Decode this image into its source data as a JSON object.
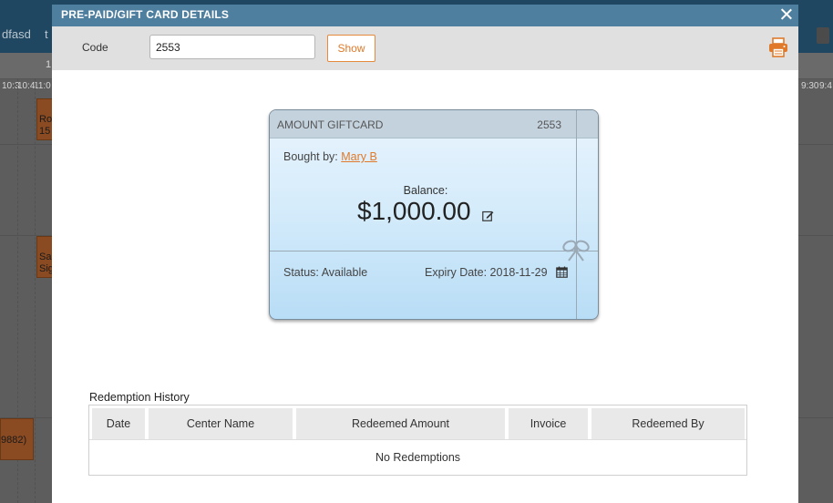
{
  "background": {
    "tabs": [
      "dfasd",
      "t"
    ],
    "hours": [
      "1",
      "10:3",
      "10:4",
      "11:0",
      "9:30",
      "9:4"
    ],
    "appointments": [
      {
        "text": "Ro 15"
      },
      {
        "text": "Sa Sig"
      },
      {
        "text": "9882)"
      }
    ]
  },
  "modal": {
    "title": "PRE-PAID/GIFT CARD DETAILS",
    "close_icon": "close-icon",
    "toolbar": {
      "code_label": "Code",
      "code_value": "2553",
      "show_label": "Show",
      "print_icon": "printer-icon"
    },
    "card": {
      "type": "AMOUNT GIFTCARD",
      "code": "2553",
      "bought_by_label": "Bought by:",
      "bought_by_name": "Mary B",
      "balance_label": "Balance:",
      "balance": "$1,000.00",
      "status": "Status: Available",
      "expiry": "Expiry Date: 2018-11-29"
    },
    "history": {
      "title": "Redemption History",
      "columns": [
        "Date",
        "Center Name",
        "Redeemed Amount",
        "Invoice",
        "Redeemed By"
      ],
      "empty_text": "No Redemptions"
    },
    "colors": {
      "header": "#4f7f9f",
      "accent": "#e07a2a",
      "toolbar": "#e0e0e0"
    }
  }
}
